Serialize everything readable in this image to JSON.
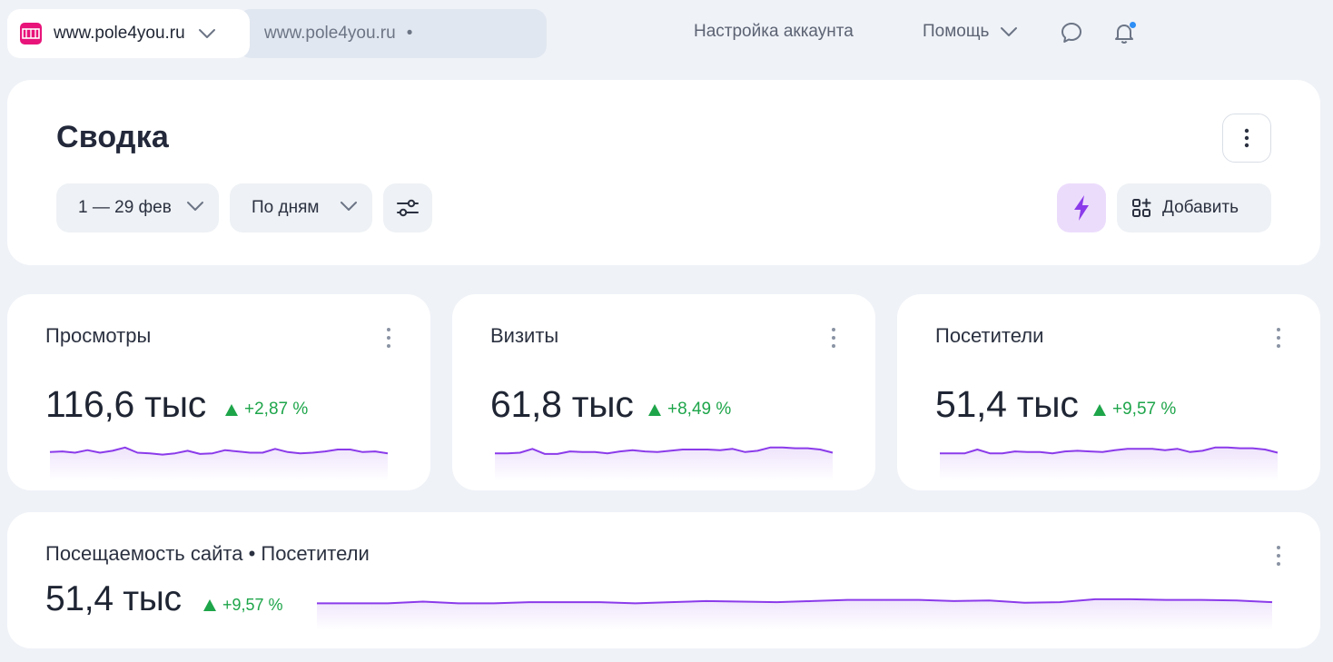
{
  "topbar": {
    "site_current": "www.pole4you.ru",
    "site_secondary": "www.pole4you.ru",
    "secondary_dot": "•",
    "settings": "Настройка аккаунта",
    "help": "Помощь"
  },
  "summary": {
    "title": "Сводка",
    "period": "1 — 29 фев",
    "grouping": "По дням",
    "add": "Добавить"
  },
  "cards": [
    {
      "title": "Просмотры",
      "value": "116,6 тыс",
      "delta": "+2,87 %",
      "trend": [
        55,
        56,
        54,
        58,
        54,
        57,
        62,
        54,
        53,
        51,
        53,
        57,
        52,
        53,
        58,
        56,
        54,
        54,
        60,
        55,
        53,
        54,
        56,
        59,
        59,
        55,
        56,
        53
      ]
    },
    {
      "title": "Визиты",
      "value": "61,8 тыс",
      "delta": "+8,49 %",
      "trend": [
        53,
        53,
        54,
        60,
        52,
        52,
        56,
        55,
        55,
        53,
        56,
        58,
        56,
        55,
        57,
        59,
        59,
        59,
        58,
        60,
        55,
        57,
        62,
        62,
        61,
        61,
        59,
        54
      ]
    },
    {
      "title": "Посетители",
      "value": "51,4 тыс",
      "delta": "+9,57 %",
      "trend": [
        53,
        53,
        53,
        59,
        53,
        53,
        56,
        55,
        55,
        53,
        56,
        57,
        56,
        55,
        58,
        60,
        60,
        60,
        58,
        60,
        55,
        57,
        62,
        62,
        61,
        61,
        59,
        54
      ]
    }
  ],
  "wide": {
    "title": "Посещаемость сайта • Посетители",
    "value": "51,4 тыс",
    "delta": "+9,57 %",
    "trend": [
      53,
      53,
      53,
      56,
      53,
      53,
      55,
      55,
      55,
      53,
      55,
      57,
      56,
      55,
      57,
      59,
      59,
      59,
      57,
      58,
      54,
      55,
      60,
      60,
      59,
      59,
      58,
      55
    ]
  },
  "colors": {
    "accent": "#8b3bea",
    "positive": "#1ea54a",
    "brand": "#e8147a",
    "notification": "#2d8ef5"
  }
}
